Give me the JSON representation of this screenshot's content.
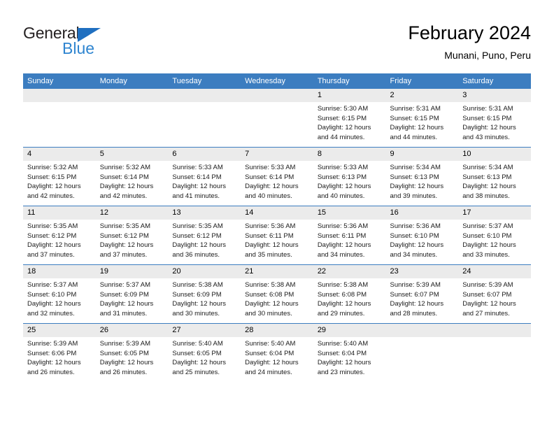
{
  "brand": {
    "word1": "General",
    "word2": "Blue",
    "triangle_color": "#1f6fc0",
    "blue_color": "#2f85d0"
  },
  "header": {
    "title": "February 2024",
    "subtitle": "Munani, Puno, Peru"
  },
  "colors": {
    "header_blue": "#3c7dc0",
    "daynum_grey": "#ebebeb",
    "cell_white": "#ffffff"
  },
  "weekdays": [
    "Sunday",
    "Monday",
    "Tuesday",
    "Wednesday",
    "Thursday",
    "Friday",
    "Saturday"
  ],
  "weeks": [
    [
      {
        "day": "",
        "l1": "",
        "l2": "",
        "l3": "",
        "l4": ""
      },
      {
        "day": "",
        "l1": "",
        "l2": "",
        "l3": "",
        "l4": ""
      },
      {
        "day": "",
        "l1": "",
        "l2": "",
        "l3": "",
        "l4": ""
      },
      {
        "day": "",
        "l1": "",
        "l2": "",
        "l3": "",
        "l4": ""
      },
      {
        "day": "1",
        "l1": "Sunrise: 5:30 AM",
        "l2": "Sunset: 6:15 PM",
        "l3": "Daylight: 12 hours",
        "l4": "and 44 minutes."
      },
      {
        "day": "2",
        "l1": "Sunrise: 5:31 AM",
        "l2": "Sunset: 6:15 PM",
        "l3": "Daylight: 12 hours",
        "l4": "and 44 minutes."
      },
      {
        "day": "3",
        "l1": "Sunrise: 5:31 AM",
        "l2": "Sunset: 6:15 PM",
        "l3": "Daylight: 12 hours",
        "l4": "and 43 minutes."
      }
    ],
    [
      {
        "day": "4",
        "l1": "Sunrise: 5:32 AM",
        "l2": "Sunset: 6:15 PM",
        "l3": "Daylight: 12 hours",
        "l4": "and 42 minutes."
      },
      {
        "day": "5",
        "l1": "Sunrise: 5:32 AM",
        "l2": "Sunset: 6:14 PM",
        "l3": "Daylight: 12 hours",
        "l4": "and 42 minutes."
      },
      {
        "day": "6",
        "l1": "Sunrise: 5:33 AM",
        "l2": "Sunset: 6:14 PM",
        "l3": "Daylight: 12 hours",
        "l4": "and 41 minutes."
      },
      {
        "day": "7",
        "l1": "Sunrise: 5:33 AM",
        "l2": "Sunset: 6:14 PM",
        "l3": "Daylight: 12 hours",
        "l4": "and 40 minutes."
      },
      {
        "day": "8",
        "l1": "Sunrise: 5:33 AM",
        "l2": "Sunset: 6:13 PM",
        "l3": "Daylight: 12 hours",
        "l4": "and 40 minutes."
      },
      {
        "day": "9",
        "l1": "Sunrise: 5:34 AM",
        "l2": "Sunset: 6:13 PM",
        "l3": "Daylight: 12 hours",
        "l4": "and 39 minutes."
      },
      {
        "day": "10",
        "l1": "Sunrise: 5:34 AM",
        "l2": "Sunset: 6:13 PM",
        "l3": "Daylight: 12 hours",
        "l4": "and 38 minutes."
      }
    ],
    [
      {
        "day": "11",
        "l1": "Sunrise: 5:35 AM",
        "l2": "Sunset: 6:12 PM",
        "l3": "Daylight: 12 hours",
        "l4": "and 37 minutes."
      },
      {
        "day": "12",
        "l1": "Sunrise: 5:35 AM",
        "l2": "Sunset: 6:12 PM",
        "l3": "Daylight: 12 hours",
        "l4": "and 37 minutes."
      },
      {
        "day": "13",
        "l1": "Sunrise: 5:35 AM",
        "l2": "Sunset: 6:12 PM",
        "l3": "Daylight: 12 hours",
        "l4": "and 36 minutes."
      },
      {
        "day": "14",
        "l1": "Sunrise: 5:36 AM",
        "l2": "Sunset: 6:11 PM",
        "l3": "Daylight: 12 hours",
        "l4": "and 35 minutes."
      },
      {
        "day": "15",
        "l1": "Sunrise: 5:36 AM",
        "l2": "Sunset: 6:11 PM",
        "l3": "Daylight: 12 hours",
        "l4": "and 34 minutes."
      },
      {
        "day": "16",
        "l1": "Sunrise: 5:36 AM",
        "l2": "Sunset: 6:10 PM",
        "l3": "Daylight: 12 hours",
        "l4": "and 34 minutes."
      },
      {
        "day": "17",
        "l1": "Sunrise: 5:37 AM",
        "l2": "Sunset: 6:10 PM",
        "l3": "Daylight: 12 hours",
        "l4": "and 33 minutes."
      }
    ],
    [
      {
        "day": "18",
        "l1": "Sunrise: 5:37 AM",
        "l2": "Sunset: 6:10 PM",
        "l3": "Daylight: 12 hours",
        "l4": "and 32 minutes."
      },
      {
        "day": "19",
        "l1": "Sunrise: 5:37 AM",
        "l2": "Sunset: 6:09 PM",
        "l3": "Daylight: 12 hours",
        "l4": "and 31 minutes."
      },
      {
        "day": "20",
        "l1": "Sunrise: 5:38 AM",
        "l2": "Sunset: 6:09 PM",
        "l3": "Daylight: 12 hours",
        "l4": "and 30 minutes."
      },
      {
        "day": "21",
        "l1": "Sunrise: 5:38 AM",
        "l2": "Sunset: 6:08 PM",
        "l3": "Daylight: 12 hours",
        "l4": "and 30 minutes."
      },
      {
        "day": "22",
        "l1": "Sunrise: 5:38 AM",
        "l2": "Sunset: 6:08 PM",
        "l3": "Daylight: 12 hours",
        "l4": "and 29 minutes."
      },
      {
        "day": "23",
        "l1": "Sunrise: 5:39 AM",
        "l2": "Sunset: 6:07 PM",
        "l3": "Daylight: 12 hours",
        "l4": "and 28 minutes."
      },
      {
        "day": "24",
        "l1": "Sunrise: 5:39 AM",
        "l2": "Sunset: 6:07 PM",
        "l3": "Daylight: 12 hours",
        "l4": "and 27 minutes."
      }
    ],
    [
      {
        "day": "25",
        "l1": "Sunrise: 5:39 AM",
        "l2": "Sunset: 6:06 PM",
        "l3": "Daylight: 12 hours",
        "l4": "and 26 minutes."
      },
      {
        "day": "26",
        "l1": "Sunrise: 5:39 AM",
        "l2": "Sunset: 6:05 PM",
        "l3": "Daylight: 12 hours",
        "l4": "and 26 minutes."
      },
      {
        "day": "27",
        "l1": "Sunrise: 5:40 AM",
        "l2": "Sunset: 6:05 PM",
        "l3": "Daylight: 12 hours",
        "l4": "and 25 minutes."
      },
      {
        "day": "28",
        "l1": "Sunrise: 5:40 AM",
        "l2": "Sunset: 6:04 PM",
        "l3": "Daylight: 12 hours",
        "l4": "and 24 minutes."
      },
      {
        "day": "29",
        "l1": "Sunrise: 5:40 AM",
        "l2": "Sunset: 6:04 PM",
        "l3": "Daylight: 12 hours",
        "l4": "and 23 minutes."
      },
      {
        "day": "",
        "l1": "",
        "l2": "",
        "l3": "",
        "l4": ""
      },
      {
        "day": "",
        "l1": "",
        "l2": "",
        "l3": "",
        "l4": ""
      }
    ]
  ]
}
